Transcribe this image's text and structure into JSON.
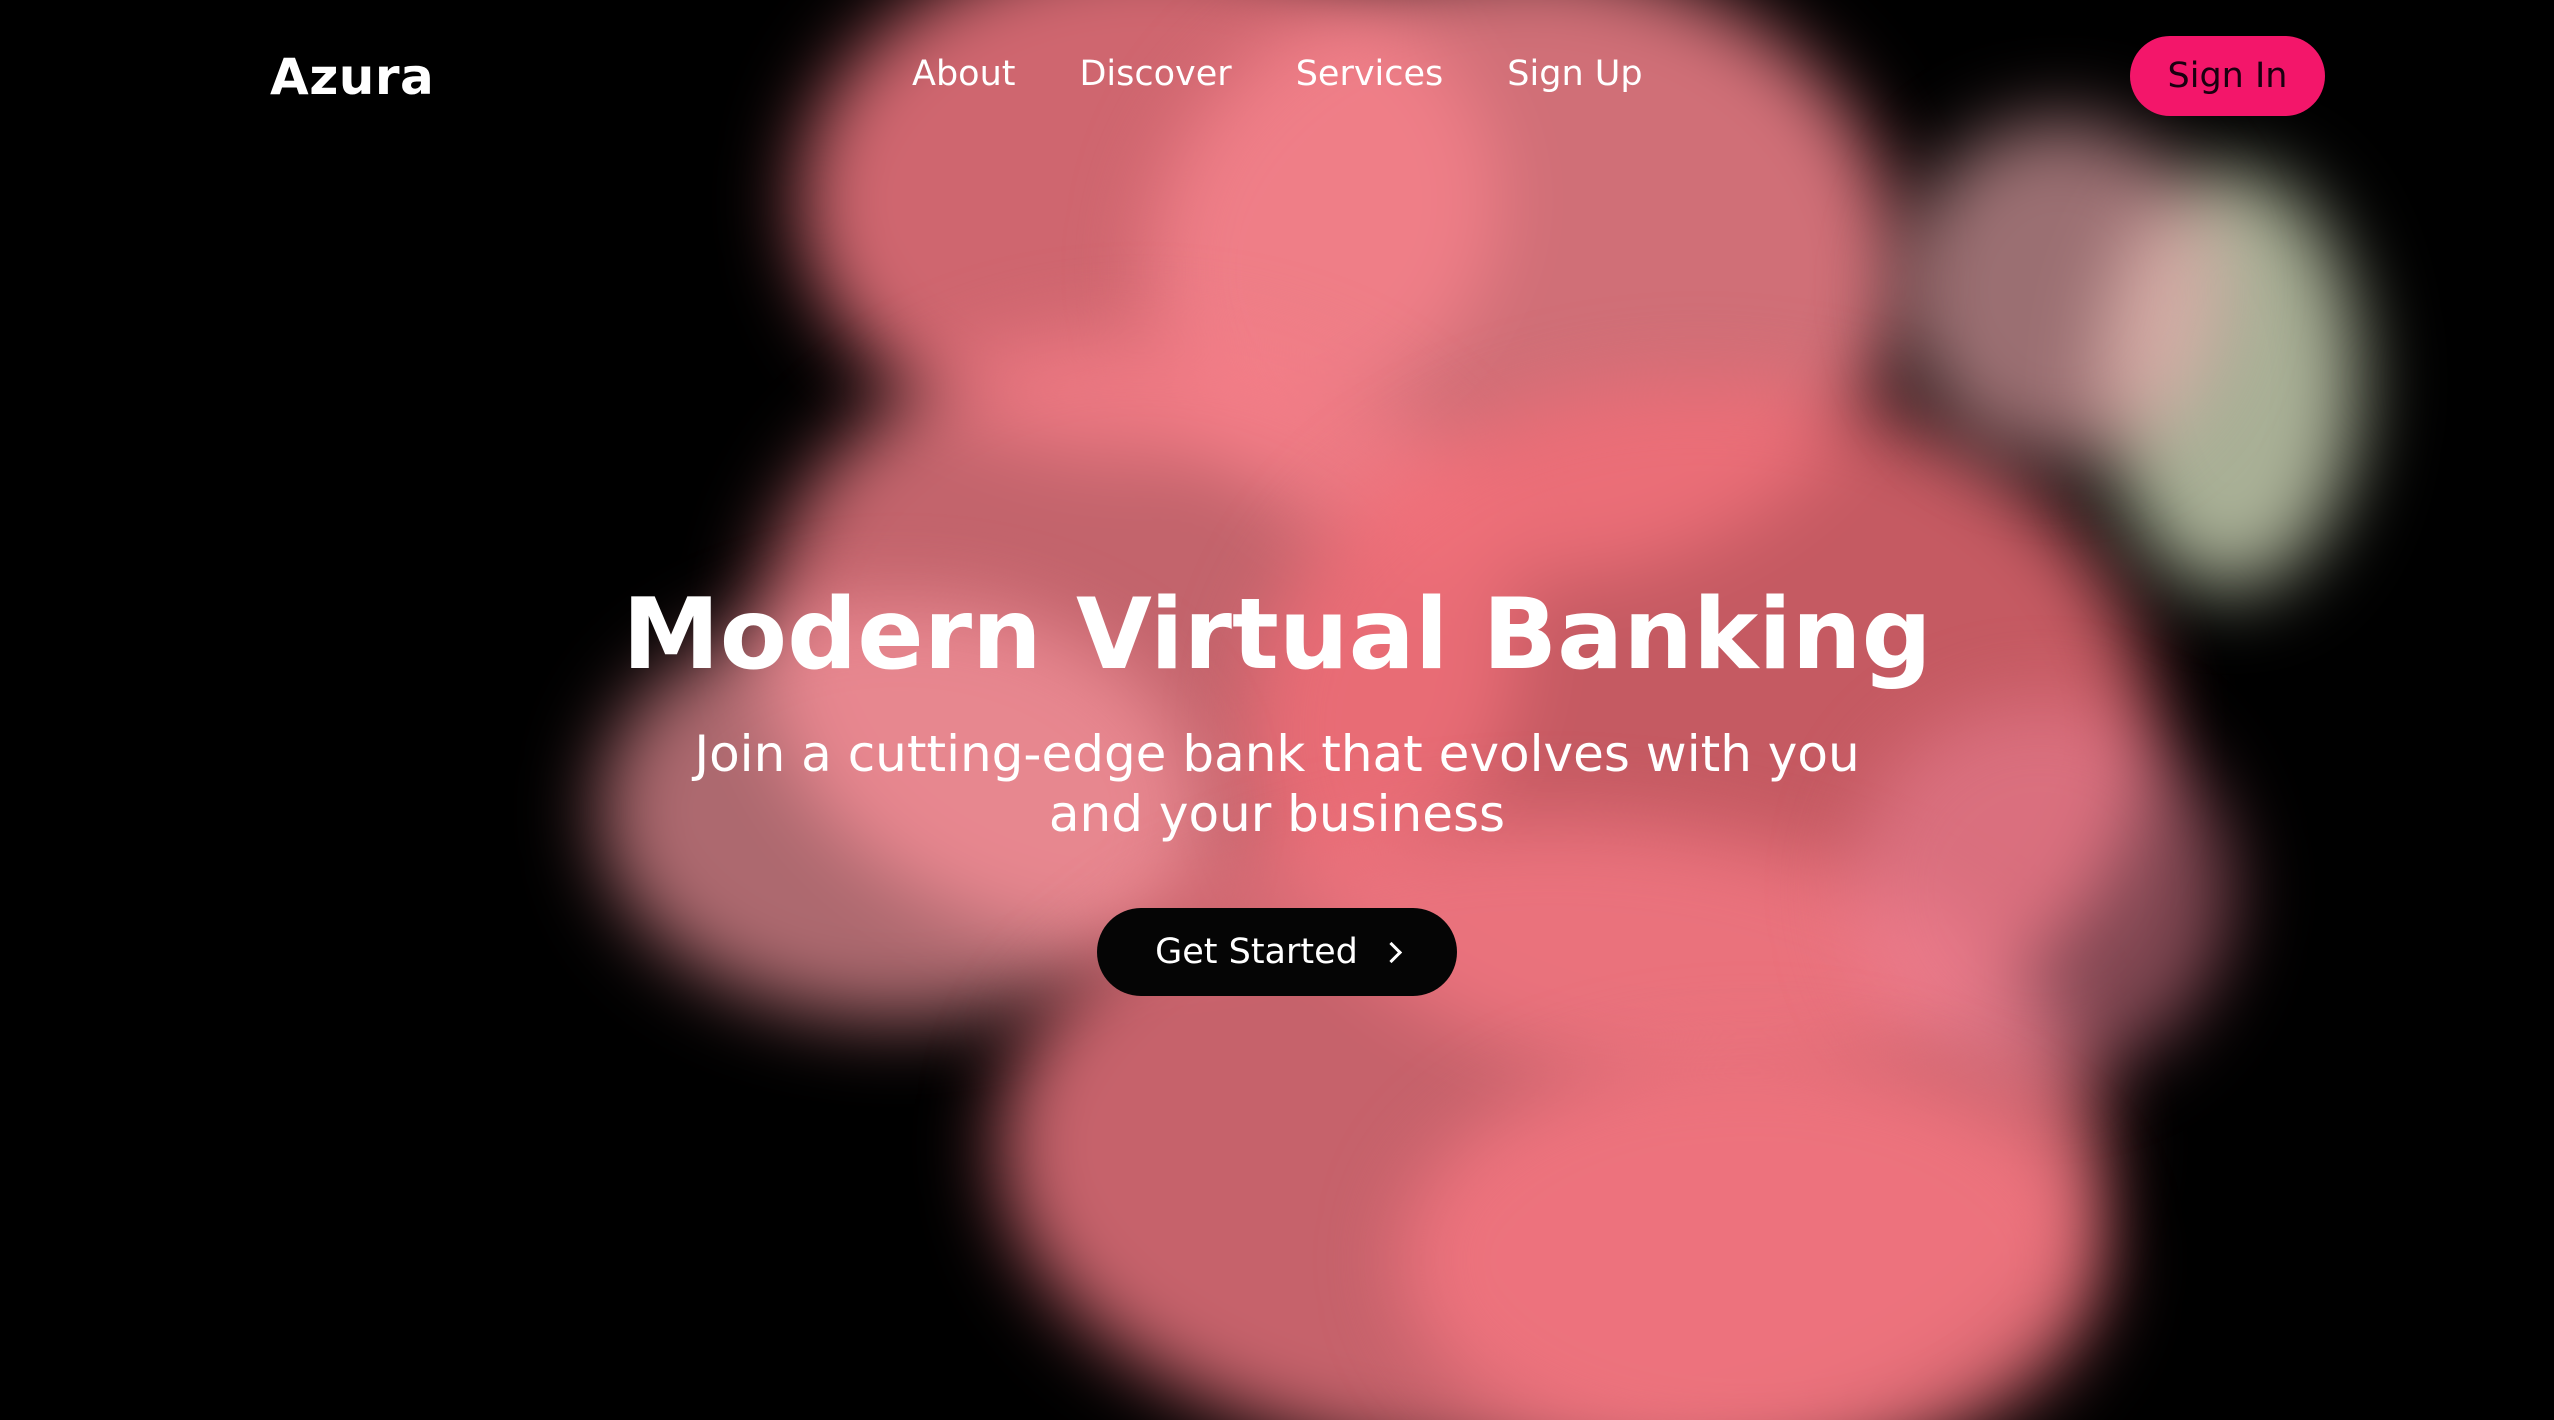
{
  "brand": {
    "name": "Azura"
  },
  "nav": {
    "links": [
      {
        "label": "About"
      },
      {
        "label": "Discover"
      },
      {
        "label": "Services"
      },
      {
        "label": "Sign Up"
      }
    ],
    "signin_label": "Sign In"
  },
  "hero": {
    "headline": "Modern Virtual Banking",
    "subheadline": "Join a cutting-edge bank that evolves with you and your business",
    "cta_label": "Get Started",
    "cta_icon": "chevron-right-icon"
  },
  "colors": {
    "background": "#000000",
    "accent": "#f3166a",
    "smoke": "#f47a82",
    "cta_background": "#050505",
    "text": "#ffffff"
  }
}
